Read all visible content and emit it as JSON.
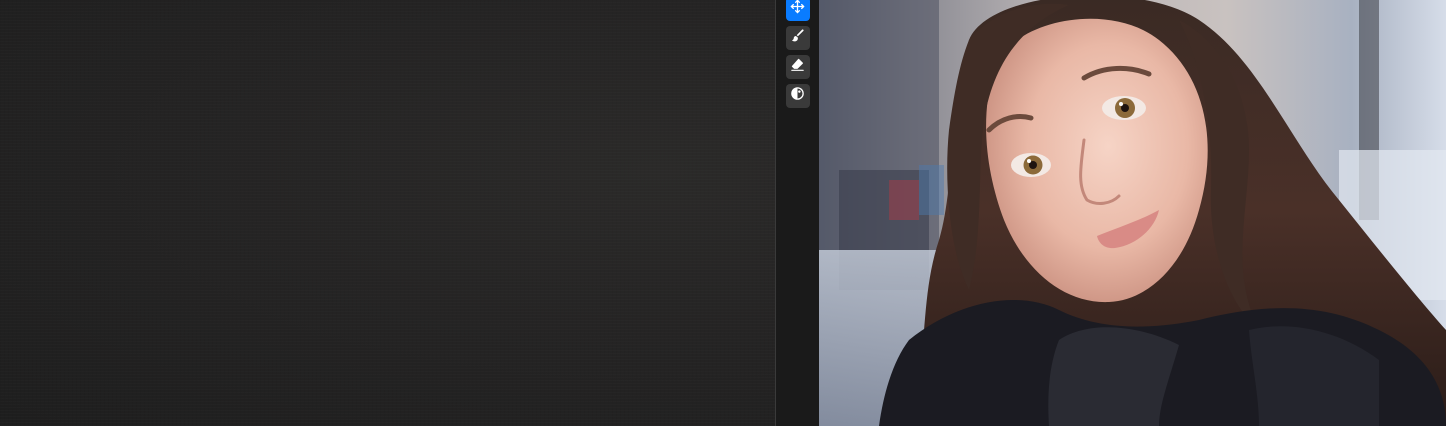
{
  "toolbar": {
    "tools": [
      {
        "icon": "move-icon",
        "active": true
      },
      {
        "icon": "brush-icon",
        "active": false
      },
      {
        "icon": "eraser-icon",
        "active": false
      },
      {
        "icon": "contrast-icon",
        "active": false
      }
    ]
  },
  "colors": {
    "accent": "#0a7cff",
    "toolbar_bg": "#1a1a1a",
    "tool_button_bg": "#3a3a3a",
    "canvas_bg": "#252424"
  },
  "photo": {
    "subject": "portrait-photo"
  }
}
